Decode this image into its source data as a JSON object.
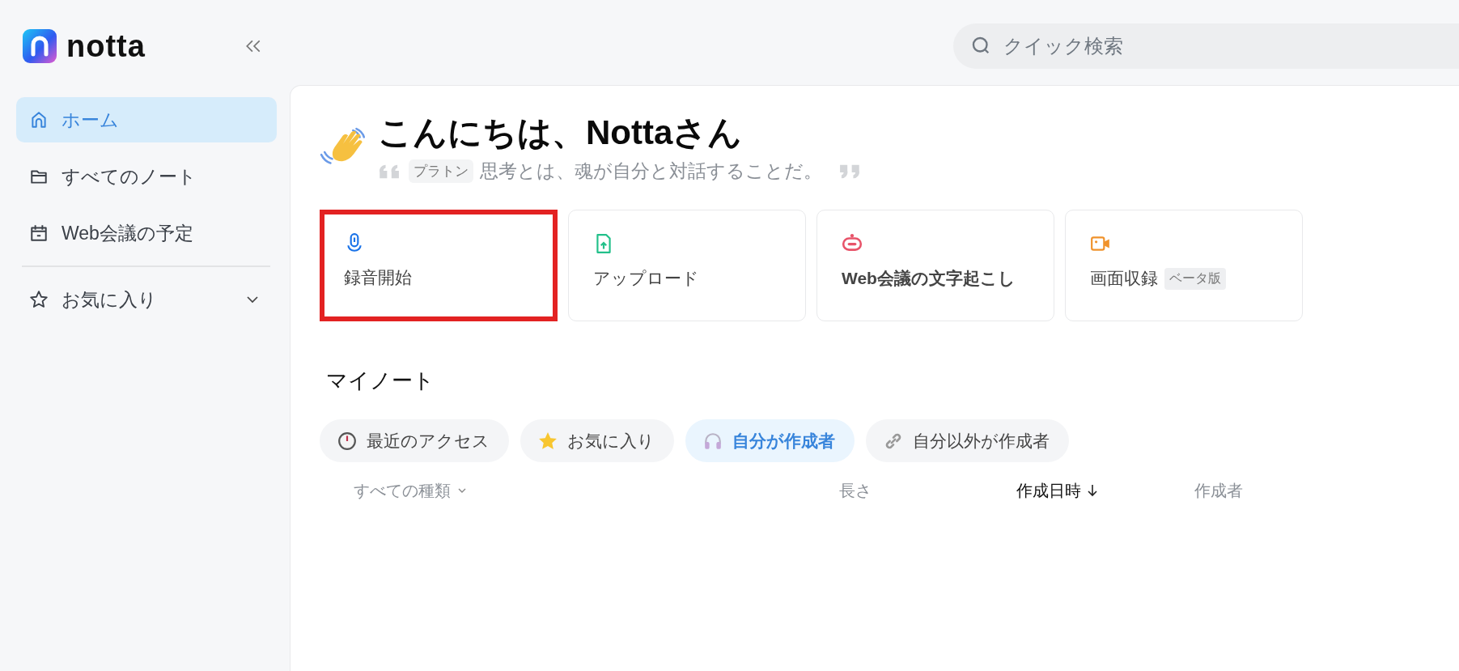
{
  "sidebar": {
    "logo": "notta",
    "items": [
      {
        "label": "ホーム",
        "kind": "home",
        "selected": true
      },
      {
        "label": "すべてのノート",
        "kind": "folder",
        "selected": false
      },
      {
        "label": "Web会議の予定",
        "kind": "calendar",
        "selected": false
      }
    ],
    "favorites": {
      "label": "お気に入り"
    }
  },
  "search": {
    "placeholder": "クイック検索"
  },
  "greeting": {
    "title": "こんにちは、Nottaさん",
    "author": "プラトン",
    "quote": "思考とは、魂が自分と対話することだ。"
  },
  "actions": [
    {
      "kind": "record",
      "label": "録音開始",
      "highlighted": true
    },
    {
      "kind": "upload",
      "label": "アップロード",
      "highlighted": false
    },
    {
      "kind": "meeting",
      "label": "Web会議の文字起こし",
      "highlighted": false
    },
    {
      "kind": "screen",
      "label": "画面収録",
      "badge": "ベータ版",
      "highlighted": false
    }
  ],
  "notes": {
    "title": "マイノート",
    "filters": [
      {
        "kind": "recent",
        "label": "最近のアクセス",
        "selected": false
      },
      {
        "kind": "favorite",
        "label": "お気に入り",
        "selected": false
      },
      {
        "kind": "mine",
        "label": "自分が作成者",
        "selected": true
      },
      {
        "kind": "others",
        "label": "自分以外が作成者",
        "selected": false
      }
    ],
    "columns": [
      {
        "label": "すべての種類",
        "kind": "dropdown",
        "active": false
      },
      {
        "label": "長さ",
        "kind": "plain",
        "active": false
      },
      {
        "label": "作成日時",
        "kind": "sort",
        "active": true
      },
      {
        "label": "作成者",
        "kind": "plain",
        "active": false
      }
    ]
  }
}
